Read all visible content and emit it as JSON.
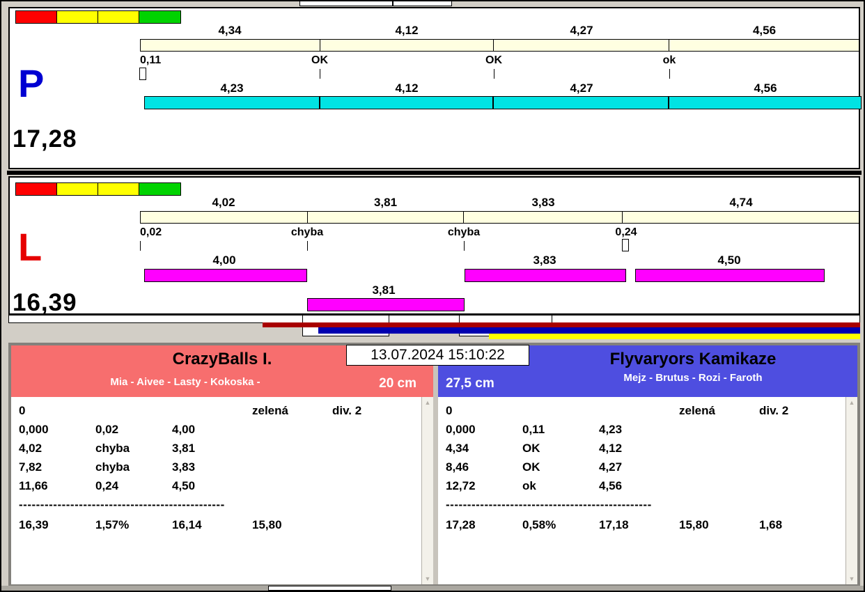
{
  "colors": {
    "lights": [
      "#ff0000",
      "#ffff00",
      "#ffff00",
      "#00d300"
    ],
    "lane_p_letter": "#0000d2",
    "lane_l_letter": "#e60000",
    "split_bar": "#ffffe1",
    "run_bar_p": "#00e3e3",
    "run_bar_l": "#ff00ff",
    "team_left_header": "#f76e6e",
    "team_right_header": "#4e4ee0",
    "progress_maroon": "#a80000",
    "progress_navy": "#0000b0",
    "progress_yellow": "#ffff00"
  },
  "timestamp": "13.07.2024 15:10:22",
  "lane_p": {
    "letter": "P",
    "total": "17,28",
    "splits": [
      "4,34",
      "4,12",
      "4,27",
      "4,56"
    ],
    "marks": [
      "0,11",
      "OK",
      "OK",
      "ok"
    ],
    "runs": [
      "4,23",
      "4,12",
      "4,27",
      "4,56"
    ]
  },
  "lane_l": {
    "letter": "L",
    "total": "16,39",
    "splits": [
      "4,02",
      "3,81",
      "3,83",
      "4,74"
    ],
    "marks": [
      "0,02",
      "chyba",
      "chyba",
      "0,24"
    ],
    "runs_row1": [
      "4,00",
      "3,83",
      "4,50"
    ],
    "run_row2": "3,81"
  },
  "team_left": {
    "name": "CrazyBalls I.",
    "dogs": "Mia - Aivee - Lasty - Kokoska -",
    "jump_height": "20 cm",
    "rows": [
      [
        "0",
        "",
        "",
        "zelená",
        "div. 2"
      ],
      [
        "0,000",
        "0,02",
        "4,00",
        "",
        ""
      ],
      [
        "4,02",
        "chyba",
        "3,81",
        "",
        ""
      ],
      [
        "7,82",
        "chyba",
        "3,83",
        "",
        ""
      ],
      [
        "11,66",
        "0,24",
        "4,50",
        "",
        ""
      ]
    ],
    "separator": "------------------------------------------------",
    "totals": [
      "16,39",
      "1,57%",
      "16,14",
      "15,80",
      ""
    ]
  },
  "team_right": {
    "name": "Flyvaryors Kamikaze",
    "dogs": "Mejz - Brutus - Rozi - Faroth",
    "jump_height": "27,5 cm",
    "rows": [
      [
        "0",
        "",
        "",
        "zelená",
        "div. 2"
      ],
      [
        "0,000",
        "0,11",
        "4,23",
        "",
        ""
      ],
      [
        "4,34",
        "OK",
        "4,12",
        "",
        ""
      ],
      [
        "8,46",
        "OK",
        "4,27",
        "",
        ""
      ],
      [
        "12,72",
        "ok",
        "4,56",
        "",
        ""
      ]
    ],
    "separator": "------------------------------------------------",
    "totals": [
      "17,28",
      "0,58%",
      "17,18",
      "15,80",
      "1,68"
    ]
  },
  "icons": {
    "scroll_up": "▲",
    "scroll_down": "▼"
  }
}
